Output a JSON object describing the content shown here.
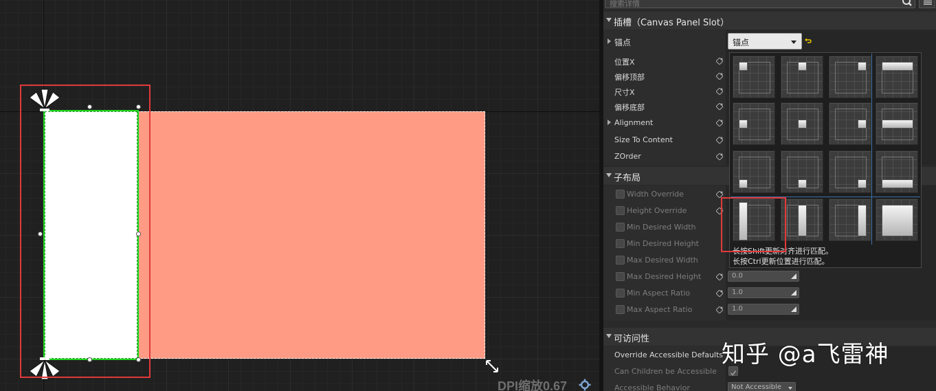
{
  "viewport": {
    "dpi_label": "DPI缩放0.67",
    "colors": {
      "salmon": "#ff9b85",
      "selection_green": "#1fd51f",
      "highlight_red": "#e23a3a"
    }
  },
  "search": {
    "placeholder": "搜索详情"
  },
  "slot_section": {
    "title": "插槽（Canvas Panel Slot）",
    "anchors_label": "锚点",
    "anchors_dropdown_value": "锚点",
    "props": [
      "位置X",
      "偏移顶部",
      "尺寸X",
      "偏移底部",
      "Alignment",
      "Size To Content",
      "ZOrder"
    ]
  },
  "child_layout": {
    "title": "子布局",
    "props": [
      "Width Override",
      "Height Override",
      "Min Desired Width",
      "Min Desired Height",
      "Max Desired Width",
      "Max Desired Height",
      "Min Aspect Ratio",
      "Max Aspect Ratio"
    ],
    "values": {
      "max_desired_height": "0.0",
      "min_aspect_ratio": "1.0",
      "max_aspect_ratio": "1.0"
    }
  },
  "anchor_popup": {
    "hint_shift": "长按Shift更新对齐进行匹配。",
    "hint_ctrl": "长按Ctrl更新位置进行匹配。"
  },
  "accessibility": {
    "title": "可访问性",
    "props": [
      "Override Accessible Defaults",
      "Can Children be Accessible",
      "Accessible Behavior"
    ],
    "behavior_value": "Not Accessible"
  },
  "watermark": "知乎 @a飞雷神"
}
